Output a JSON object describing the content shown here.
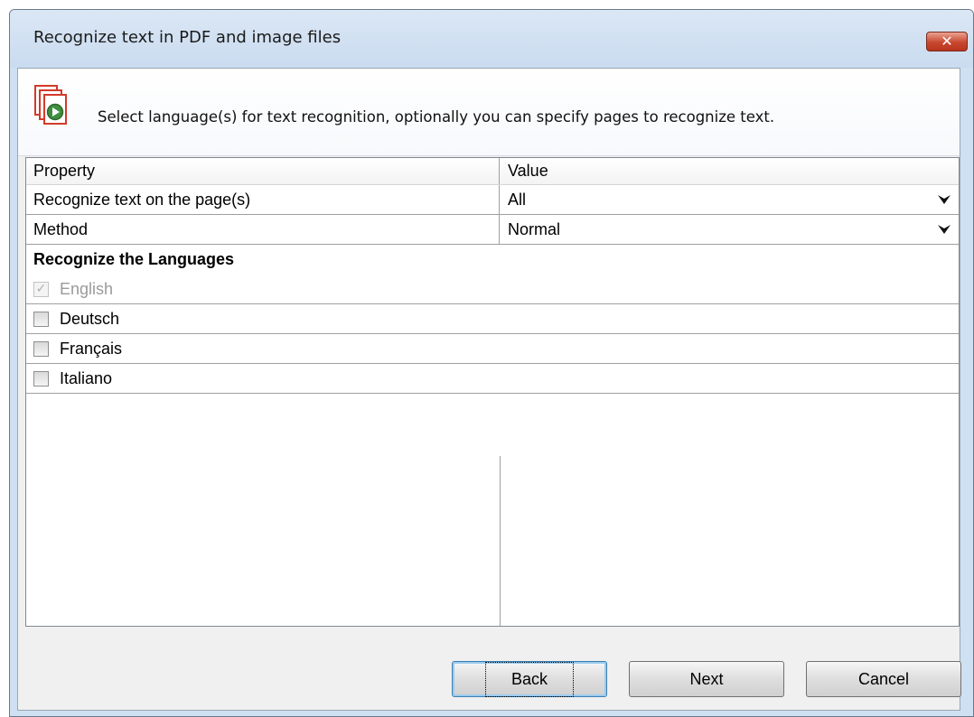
{
  "window": {
    "title": "Recognize text in PDF and image files",
    "close_glyph": "✕"
  },
  "banner": {
    "icon": "pdf-pages-play-icon",
    "text": "Select language(s) for text recognition, optionally you can specify pages to recognize text."
  },
  "grid": {
    "headers": {
      "property": "Property",
      "value": "Value"
    },
    "rows": [
      {
        "property": "Recognize text on the page(s)",
        "value": "All"
      },
      {
        "property": "Method",
        "value": "Normal"
      }
    ],
    "section_title": "Recognize the Languages",
    "languages": [
      {
        "label": "English",
        "checked": true,
        "disabled": true
      },
      {
        "label": "Deutsch",
        "checked": false,
        "disabled": false
      },
      {
        "label": "Français",
        "checked": false,
        "disabled": false
      },
      {
        "label": "Italiano",
        "checked": false,
        "disabled": false
      }
    ]
  },
  "buttons": {
    "back": "Back",
    "next": "Next",
    "cancel": "Cancel"
  },
  "colors": {
    "title_bar": "#cfe0f2",
    "close_button": "#c9472f",
    "default_button_border": "#3c7fb1"
  }
}
